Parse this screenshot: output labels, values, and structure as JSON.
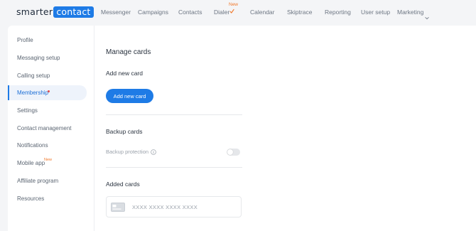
{
  "brand": {
    "part1": "smarter",
    "part2": "contact"
  },
  "nav": {
    "items": [
      {
        "label": "Messenger"
      },
      {
        "label": "Campaigns"
      },
      {
        "label": "Contacts"
      },
      {
        "label": "Dialer",
        "badge": "New"
      },
      {
        "label": "Calendar"
      },
      {
        "label": "Skiptrace"
      },
      {
        "label": "Reporting"
      },
      {
        "label": "User setup"
      },
      {
        "label": "Marketing"
      }
    ]
  },
  "sidebar": {
    "active": "Membership",
    "items": [
      {
        "label": "Profile"
      },
      {
        "label": "Messaging setup"
      },
      {
        "label": "Calling setup"
      },
      {
        "label": "Membership"
      },
      {
        "label": "Settings"
      },
      {
        "label": "Contact management"
      },
      {
        "label": "Notifications"
      },
      {
        "label": "Mobile app",
        "badge": "New"
      },
      {
        "label": "Affiliate program"
      },
      {
        "label": "Resources"
      }
    ]
  },
  "main": {
    "title": "Manage cards",
    "add_new": {
      "heading": "Add new card",
      "button": "Add new card"
    },
    "backup": {
      "heading": "Backup cards",
      "protection_label": "Backup protection",
      "protection_on": false
    },
    "added": {
      "heading": "Added cards",
      "card_number": "XXXX XXXX XXXX XXXX"
    }
  },
  "colors": {
    "accent": "#1e7be6",
    "badge": "#f0772a",
    "dot": "#e24b4b"
  }
}
